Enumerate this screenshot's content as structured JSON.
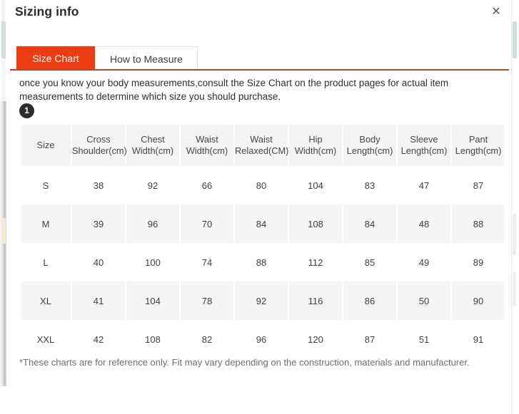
{
  "modal": {
    "title": "Sizing info",
    "close_icon": "close-icon",
    "close_glyph": "✕"
  },
  "tabs": [
    {
      "label": "Size Chart",
      "active": true
    },
    {
      "label": "How to Measure",
      "active": false
    }
  ],
  "intro": {
    "text": "once you know your body measurements,consult the Size Chart on the product pages for actual item measurements to determine which size you should purchase.",
    "badge": "1"
  },
  "table": {
    "headers": [
      "Size",
      "Cross Shoulder(cm)",
      "Chest Width(cm)",
      "Waist Width(cm)",
      "Waist Relaxed(CM)",
      "Hip Width(cm)",
      "Body Length(cm)",
      "Sleeve Length(cm)",
      "Pant Length(cm)"
    ],
    "rows": [
      [
        "S",
        "38",
        "92",
        "66",
        "80",
        "104",
        "83",
        "47",
        "87"
      ],
      [
        "M",
        "39",
        "96",
        "70",
        "84",
        "108",
        "84",
        "48",
        "88"
      ],
      [
        "L",
        "40",
        "100",
        "74",
        "88",
        "112",
        "85",
        "49",
        "89"
      ],
      [
        "XL",
        "41",
        "104",
        "78",
        "92",
        "116",
        "86",
        "50",
        "90"
      ],
      [
        "XXL",
        "42",
        "108",
        "82",
        "96",
        "120",
        "87",
        "51",
        "91"
      ]
    ]
  },
  "footnote": {
    "text": "*These charts are for reference only. Fit may vary depending on the construction, materials and manufacturer."
  },
  "colors": {
    "accent": "#ec3c12",
    "accent_underline": "#c0441f",
    "badge": "#2c2c2c",
    "header_cell": "#f4f4f4",
    "row_alt": "#f5f5f5"
  }
}
